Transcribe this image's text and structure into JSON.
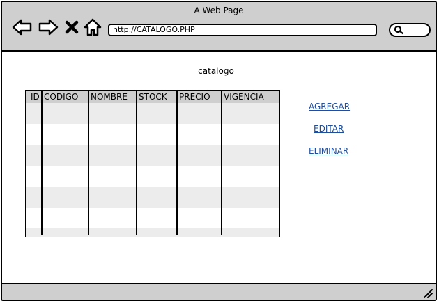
{
  "window": {
    "title": "A Web Page"
  },
  "toolbar": {
    "back_icon": "back-arrow-icon",
    "forward_icon": "forward-arrow-icon",
    "stop_icon": "close-icon",
    "home_icon": "home-icon",
    "search_icon": "search-icon"
  },
  "address_bar": {
    "value": "http://CATALOGO.PHP"
  },
  "page": {
    "title": "catalogo"
  },
  "table": {
    "columns": [
      "ID",
      "CODIGO",
      "NOMBRE",
      "STOCK",
      "PRECIO",
      "VIGENCIA"
    ],
    "rows": []
  },
  "actions": {
    "add": "AGREGAR",
    "edit": "EDITAR",
    "delete": "ELIMINAR"
  },
  "colors": {
    "chrome_gray": "#cfcfcf",
    "link_blue": "#1f4e9c",
    "row_stripe": "#ececec"
  }
}
